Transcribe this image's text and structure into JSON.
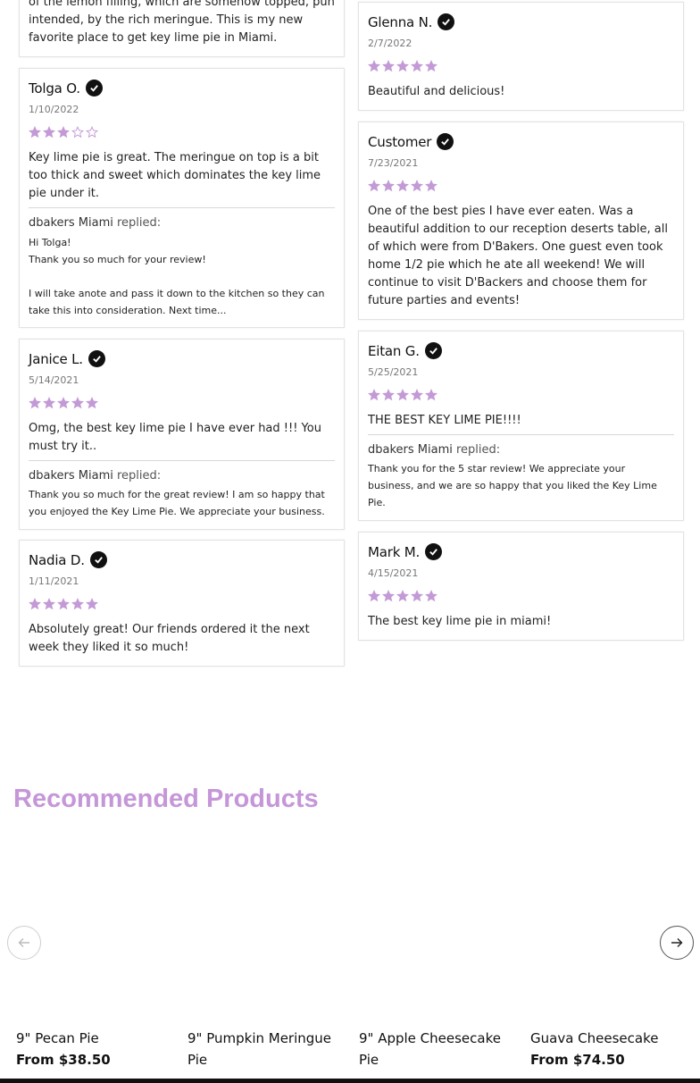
{
  "reviews_left": [
    {
      "body": "of the lemon filling, which are somehow topped, pun intended, by the rich meringue. This is my new favorite place to get key lime pie in Miami."
    },
    {
      "author": "Tolga O.",
      "date": "1/10/2022",
      "rating": 3,
      "body": "Key lime pie is great. The meringue on top is a bit too thick and sweet which dominates the key lime pie under it.",
      "reply_author": "dbakers Miami",
      "reply_label": "replied:",
      "reply": "Hi Tolga!\nThank you so much for your review!\n\nI will take anote and pass it down to the kitchen so they can take this into consideration. Next time..."
    },
    {
      "author": "Janice L.",
      "date": "5/14/2021",
      "rating": 5,
      "body": "Omg, the best key lime pie I have ever had !!! You must try it..",
      "reply_author": "dbakers Miami",
      "reply_label": "replied:",
      "reply": "Thank you so much for the great review! I am so happy that you enjoyed the Key Lime Pie. We appreciate your business."
    },
    {
      "author": "Nadia D.",
      "date": "1/11/2021",
      "rating": 5,
      "body": "Absolutely great! Our friends ordered it the next week they liked it so much!"
    }
  ],
  "reviews_right": [
    {
      "author": "Glenna N.",
      "date": "2/7/2022",
      "rating": 5,
      "body": "Beautiful and delicious!"
    },
    {
      "author": "Customer",
      "date": "7/23/2021",
      "rating": 5,
      "body": "One of the best pies I have ever eaten. Was a beautiful addition to our reception deserts table, all of which were from D'Bakers. One guest even took home 1/2 pie which he ate all weekend! We will continue to visit D'Backers and choose them for future parties and events!"
    },
    {
      "author": "Eitan G.",
      "date": "5/25/2021",
      "rating": 5,
      "body": "THE BEST KEY LIME PIE!!!!",
      "reply_author": "dbakers Miami",
      "reply_label": "replied:",
      "reply": "Thank you for the 5 star review! We appreciate your business, and we are so happy that you liked the Key Lime Pie."
    },
    {
      "author": "Mark M.",
      "date": "4/15/2021",
      "rating": 5,
      "body": "The best key lime pie in miami!"
    }
  ],
  "recommended": {
    "title": "Recommended Products",
    "products": [
      {
        "name": "9\" Pecan Pie",
        "price": "From $38.50"
      },
      {
        "name": "9\" Pumpkin Meringue Pie",
        "price": ""
      },
      {
        "name": "9\" Apple Cheesecake Pie",
        "price": ""
      },
      {
        "name": "Guava Cheesecake",
        "price": "From $74.50"
      }
    ]
  },
  "colors": {
    "star": "#c39ad6",
    "accent": "#c597d8"
  },
  "icons": {
    "verified": "check-circle-icon",
    "prev": "arrow-left-icon",
    "next": "arrow-right-icon",
    "star": "star-icon"
  }
}
